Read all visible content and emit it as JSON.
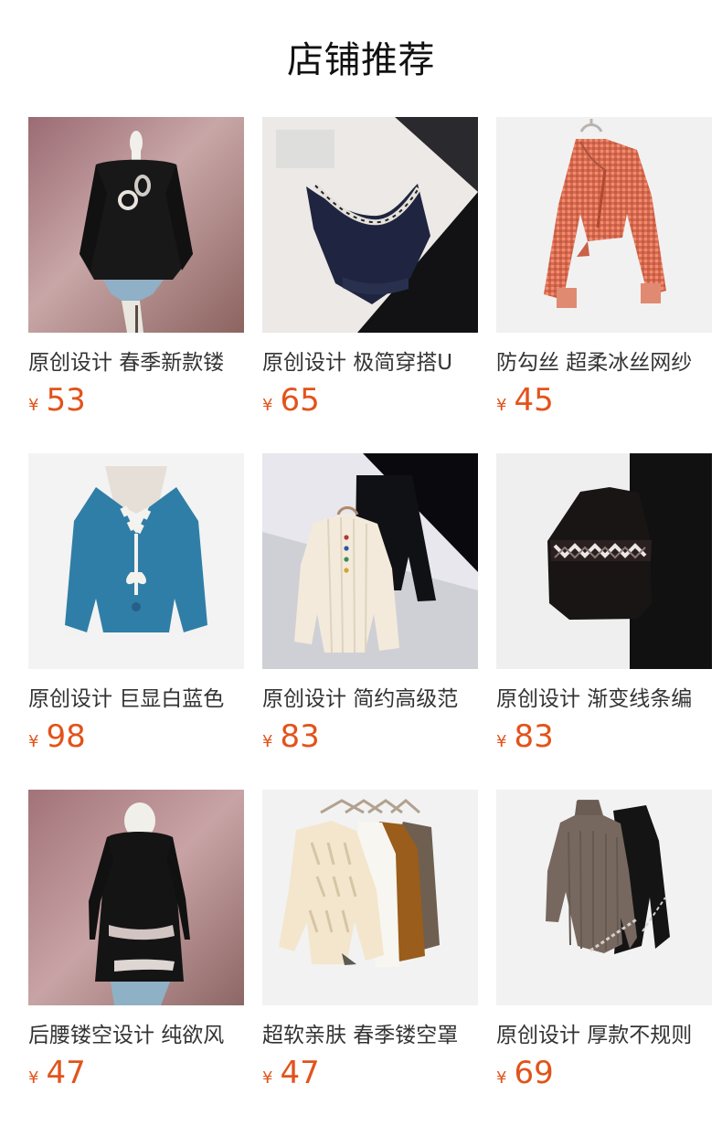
{
  "header": {
    "title": "店铺推荐"
  },
  "products": [
    {
      "name": "原创设计 春季新款镂",
      "currency": "¥",
      "price": "53",
      "image_icon": "black-openknit-top-photo"
    },
    {
      "name": "原创设计 极简穿搭U",
      "currency": "¥",
      "price": "65",
      "image_icon": "navy-vest-photo"
    },
    {
      "name": "防勾丝 超柔冰丝网纱",
      "currency": "¥",
      "price": "45",
      "image_icon": "orange-gingham-cardigan-photo"
    },
    {
      "name": "原创设计 巨显白蓝色",
      "currency": "¥",
      "price": "98",
      "image_icon": "blue-cardigan-photo"
    },
    {
      "name": "原创设计 简约高级范",
      "currency": "¥",
      "price": "83",
      "image_icon": "cream-ribbed-top-photo"
    },
    {
      "name": "原创设计 渐变线条编",
      "currency": "¥",
      "price": "83",
      "image_icon": "black-knit-vest-photo"
    },
    {
      "name": "后腰镂空设计 纯欲风",
      "currency": "¥",
      "price": "47",
      "image_icon": "black-cutout-top-photo"
    },
    {
      "name": "超软亲肤 春季镂空罩",
      "currency": "¥",
      "price": "47",
      "image_icon": "hanging-sweaters-photo"
    },
    {
      "name": "原创设计 厚款不规则",
      "currency": "¥",
      "price": "69",
      "image_icon": "turtleneck-pair-photo"
    }
  ],
  "colors": {
    "price": "#e2531b",
    "text": "#333333",
    "title": "#111111",
    "background": "#ffffff"
  }
}
